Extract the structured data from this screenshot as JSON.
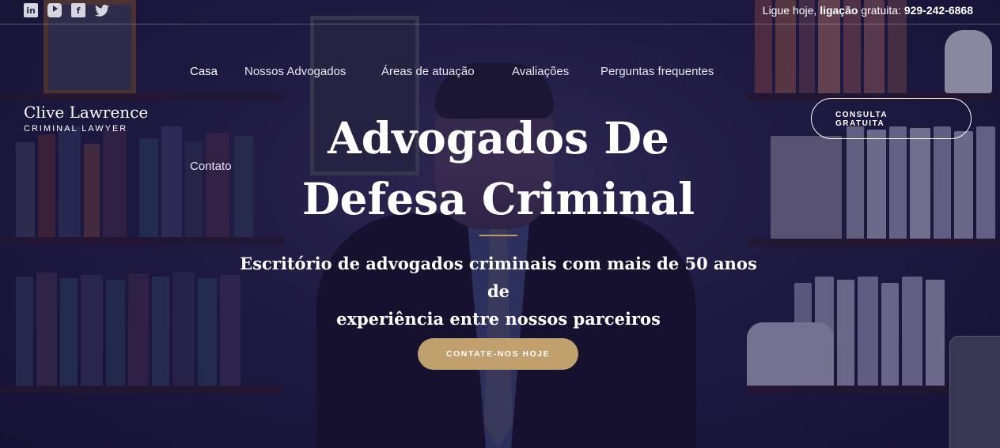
{
  "topbar": {
    "social_icons": [
      "linkedin-icon",
      "youtube-icon",
      "facebook-icon",
      "twitter-icon"
    ],
    "phone_prefix": "Ligue hoje, ",
    "phone_bold": "ligação",
    "phone_middle": " gratuita: ",
    "phone_number": "929-242-6868"
  },
  "brand": {
    "name": "Clive Lawrence",
    "tagline": "CRIMINAL LAWYER"
  },
  "nav": {
    "items": [
      "Casa",
      "Nossos Advogados",
      "Áreas de atuação",
      "Avaliações",
      "Perguntas frequentes",
      "Contato"
    ],
    "active": "Casa"
  },
  "consult_button": {
    "line1": "CONSULTA",
    "line2": "GRATUITA"
  },
  "hero": {
    "title_line1": "Advogados De",
    "title_line2": "Defesa Criminal",
    "subtitle_line1": "Escritório de advogados criminais com mais de 50 anos de",
    "subtitle_line2": "experiência entre nossos parceiros",
    "cta_label": "CONTATE-NOS HOJE"
  },
  "colors": {
    "accent": "#c0a06c",
    "overlay": "#16123a"
  }
}
